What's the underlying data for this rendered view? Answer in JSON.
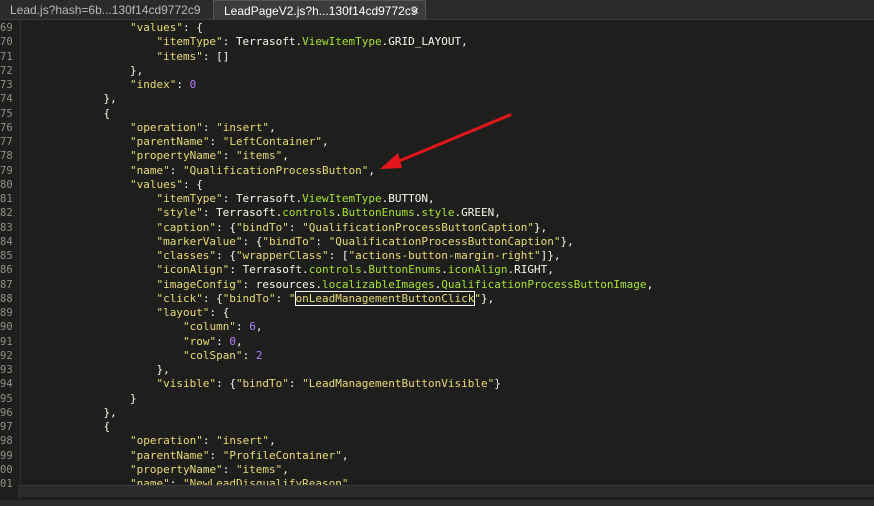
{
  "tabs": [
    {
      "label": "Lead.js?hash=6b...130f14cd9772c9",
      "active": false
    },
    {
      "label": "LeadPageV2.js?h...130f14cd9772c9",
      "active": true,
      "close": "×"
    }
  ],
  "lines": [
    {
      "n": "69",
      "t": "                \"values\": {"
    },
    {
      "n": "70",
      "t": "                    \"itemType\": Terrasoft.ViewItemType.GRID_LAYOUT,"
    },
    {
      "n": "71",
      "t": "                    \"items\": []"
    },
    {
      "n": "72",
      "t": "                },"
    },
    {
      "n": "73",
      "t": "                \"index\": 0"
    },
    {
      "n": "74",
      "t": "            },"
    },
    {
      "n": "75",
      "t": "            {"
    },
    {
      "n": "76",
      "t": "                \"operation\": \"insert\","
    },
    {
      "n": "77",
      "t": "                \"parentName\": \"LeftContainer\","
    },
    {
      "n": "78",
      "t": "                \"propertyName\": \"items\","
    },
    {
      "n": "79",
      "t": "                \"name\": \"QualificationProcessButton\","
    },
    {
      "n": "80",
      "t": "                \"values\": {"
    },
    {
      "n": "81",
      "t": "                    \"itemType\": Terrasoft.ViewItemType.BUTTON,"
    },
    {
      "n": "82",
      "t": "                    \"style\": Terrasoft.controls.ButtonEnums.style.GREEN,"
    },
    {
      "n": "83",
      "t": "                    \"caption\": {\"bindTo\": \"QualificationProcessButtonCaption\"},"
    },
    {
      "n": "84",
      "t": "                    \"markerValue\": {\"bindTo\": \"QualificationProcessButtonCaption\"},"
    },
    {
      "n": "85",
      "t": "                    \"classes\": {\"wrapperClass\": [\"actions-button-margin-right\"]},"
    },
    {
      "n": "86",
      "t": "                    \"iconAlign\": Terrasoft.controls.ButtonEnums.iconAlign.RIGHT,"
    },
    {
      "n": "87",
      "t": "                    \"imageConfig\": resources.localizableImages.QualificationProcessButtonImage,"
    },
    {
      "n": "88",
      "t": "                    \"click\": {\"bindTo\": \"onLeadManagementButtonClick\"},"
    },
    {
      "n": "89",
      "t": "                    \"layout\": {"
    },
    {
      "n": "90",
      "t": "                        \"column\": 6,"
    },
    {
      "n": "91",
      "t": "                        \"row\": 0,"
    },
    {
      "n": "92",
      "t": "                        \"colSpan\": 2"
    },
    {
      "n": "93",
      "t": "                    },"
    },
    {
      "n": "94",
      "t": "                    \"visible\": {\"bindTo\": \"LeadManagementButtonVisible\"}"
    },
    {
      "n": "95",
      "t": "                }"
    },
    {
      "n": "96",
      "t": "            },"
    },
    {
      "n": "97",
      "t": "            {"
    },
    {
      "n": "98",
      "t": "                \"operation\": \"insert\","
    },
    {
      "n": "99",
      "t": "                \"parentName\": \"ProfileContainer\","
    },
    {
      "n": "00",
      "t": "                \"propertyName\": \"items\","
    },
    {
      "n": "01",
      "t": "                \"name\": \"NewLeadDisqualifyReason\","
    }
  ],
  "highlight": {
    "line": "88",
    "text": "onLeadManagementButtonClick"
  },
  "colors": {
    "string": "#e6db74",
    "number": "#ae81ff",
    "identifier": "#a6e22e",
    "plain": "#f8f8f2",
    "arrow": "#e3161b"
  }
}
